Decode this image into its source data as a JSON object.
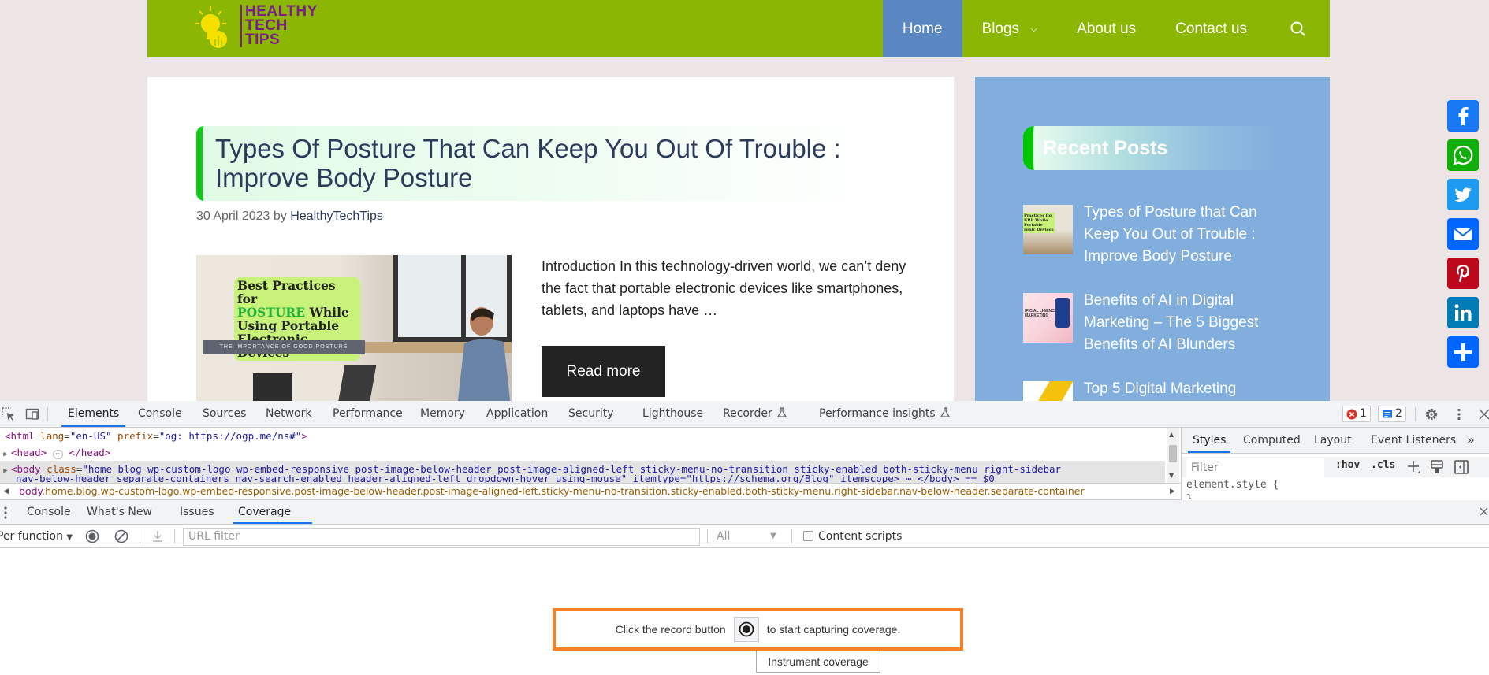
{
  "site": {
    "logo": {
      "line1": "HEALTHY",
      "line2": "TECH",
      "line3": "TIPS"
    },
    "nav": [
      {
        "label": "Home",
        "active": true
      },
      {
        "label": "Blogs",
        "has_dropdown": true
      },
      {
        "label": "About us"
      },
      {
        "label": "Contact us"
      }
    ],
    "nav_search_icon": "search-icon",
    "post": {
      "title": "Types Of Posture That Can Keep You Out Of Trouble : Improve Body Posture",
      "date": "30 April 2023",
      "by": "by",
      "author": "HealthyTechTips",
      "image": {
        "line1": "Best Practices for",
        "highlight": "POSTURE",
        "line2_rest": " While",
        "line3": "Using Portable",
        "line4": "Electronic Devices",
        "band": "THE IMPORTANCE OF GOOD POSTURE"
      },
      "excerpt": "Introduction In this technology-driven world, we can’t deny the fact that portable electronic devices like smartphones, tablets, and laptops have …",
      "read_more": "Read more"
    },
    "sidebar": {
      "heading": "Recent Posts",
      "posts": [
        {
          "title": "Types of Posture that Can Keep You Out of Trouble : Improve Body Posture",
          "thumb_text": "Practices for URE While Portable ronic Devices"
        },
        {
          "title": "Benefits of AI in Digital Marketing – The 5 Biggest Benefits of AI Blunders",
          "thumb_text": "IFICIAL LIGENCE IN MARKETING"
        },
        {
          "title": "Top 5 Digital Marketing"
        }
      ]
    },
    "share": [
      {
        "name": "facebook",
        "color": "#1877f2"
      },
      {
        "name": "whatsapp",
        "color": "#12af0a"
      },
      {
        "name": "twitter",
        "color": "#1d9bf0"
      },
      {
        "name": "email",
        "color": "#0166ff"
      },
      {
        "name": "pinterest",
        "color": "#bd081c"
      },
      {
        "name": "linkedin",
        "color": "#007bb5"
      },
      {
        "name": "share",
        "color": "#0166ff"
      }
    ]
  },
  "devtools": {
    "tabs": [
      "Elements",
      "Console",
      "Sources",
      "Network",
      "Performance",
      "Memory",
      "Application",
      "Security",
      "Lighthouse",
      "Recorder",
      "Performance insights"
    ],
    "active_tab": "Elements",
    "errors_count": "1",
    "messages_count": "2",
    "dom": {
      "html_line": {
        "tag": "html",
        "attr1": "lang",
        "val1": "\"en-US\"",
        "attr2": "prefix",
        "val2": "\"og: https://ogp.me/ns#\""
      },
      "head_line": {
        "open": "<head>",
        "ellipsis": "⋯",
        "close": "</head>"
      },
      "body_line": {
        "tag": "body",
        "attr": "class",
        "val": "\"home blog wp-custom-logo wp-embed-responsive post-image-below-header post-image-aligned-left sticky-menu-no-transition sticky-enabled both-sticky-menu right-sidebar"
      },
      "body_line2": "nav-below-header separate-containers nav-search-enabled header-aligned-left dropdown-hover using-mouse\" itemtype=\"https://schema.org/Blog\" itemscope> ⋯ </body> == $0"
    },
    "breadcrumb": {
      "tag": "body",
      "classes": ".home.blog.wp-custom-logo.wp-embed-responsive.post-image-below-header.post-image-aligned-left.sticky-menu-no-transition.sticky-enabled.both-sticky-menu.right-sidebar.nav-below-header.separate-container"
    },
    "styles_tabs": [
      "Styles",
      "Computed",
      "Layout",
      "Event Listeners"
    ],
    "styles_active": "Styles",
    "styles_more": "»",
    "filter_placeholder": "Filter",
    "hov_label": ":hov",
    "cls_label": ".cls",
    "element_style": "element.style {",
    "element_style_close": "}",
    "drawer_tabs": [
      "Console",
      "What's New",
      "Issues",
      "Coverage"
    ],
    "drawer_active": "Coverage",
    "coverage": {
      "mode": "Per function",
      "url_filter_placeholder": "URL filter",
      "type_filter": "All",
      "content_scripts": "Content scripts",
      "content_scripts_checked": false,
      "message_before": "Click the record button",
      "message_after": "to start capturing coverage.",
      "tooltip": "Instrument coverage"
    }
  }
}
